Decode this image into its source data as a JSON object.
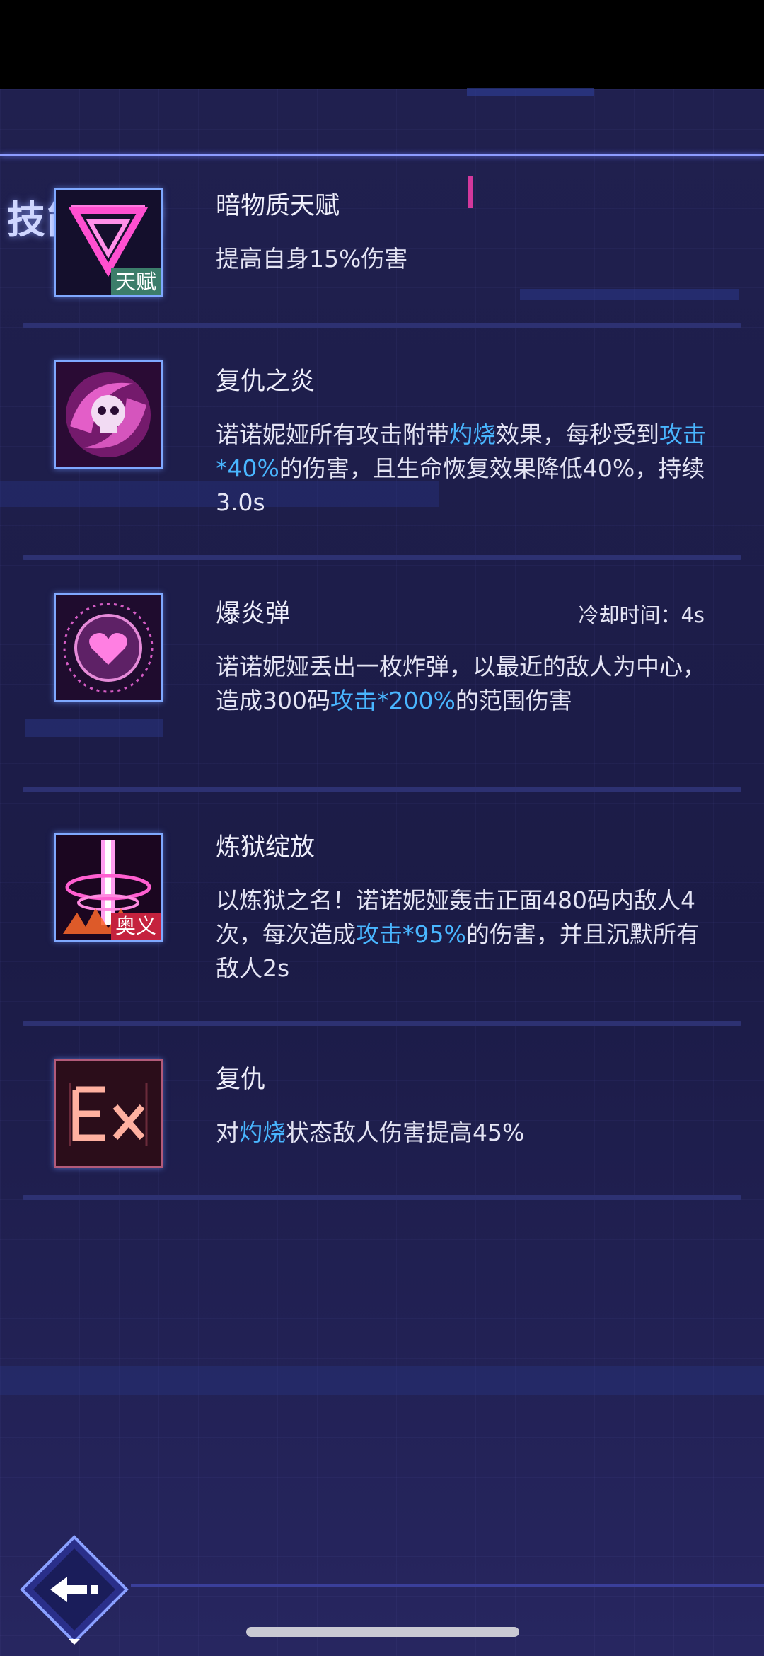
{
  "header": {
    "title": "技能详情"
  },
  "skills": [
    {
      "name": "暗物质天赋",
      "tag": "天赋",
      "cooldown": "",
      "desc": [
        {
          "t": "提高自身15%伤害"
        }
      ]
    },
    {
      "name": "复仇之炎",
      "tag": "",
      "cooldown": "",
      "desc": [
        {
          "t": "诺诺妮娅所有攻击附带"
        },
        {
          "t": "灼烧",
          "hl": true
        },
        {
          "t": "效果，每秒受到"
        },
        {
          "t": "攻击*40%",
          "hl": true
        },
        {
          "t": "的伤害，且生命恢复效果降低40%，持续3.0s"
        }
      ]
    },
    {
      "name": "爆炎弹",
      "tag": "",
      "cooldown": "冷却时间：4s",
      "desc": [
        {
          "t": "诺诺妮娅丢出一枚炸弹，以最近的敌人为中心，造成300码"
        },
        {
          "t": "攻击*200%",
          "hl": true
        },
        {
          "t": "的范围伤害"
        }
      ]
    },
    {
      "name": "炼狱绽放",
      "tag": "奥义",
      "cooldown": "",
      "desc": [
        {
          "t": "以炼狱之名！诺诺妮娅轰击正面480码内敌人4次，每次造成"
        },
        {
          "t": "攻击*95%",
          "hl": true
        },
        {
          "t": "的伤害，并且沉默所有敌人2s"
        }
      ]
    },
    {
      "name": "复仇",
      "tag": "",
      "cooldown": "",
      "desc": [
        {
          "t": "对"
        },
        {
          "t": "灼烧",
          "hl": true
        },
        {
          "t": "状态敌人伤害提高45%"
        }
      ]
    }
  ],
  "icons": [
    "dark-matter-triangle-icon",
    "skull-flame-icon",
    "heart-bomb-icon",
    "pillar-burst-icon",
    "ex-icon",
    "back-arrow-icon"
  ],
  "colors": {
    "highlight": "#49b6ff",
    "talent_tag": "#3c7d6a",
    "ult_tag": "#c5223e",
    "frame": "#7fa8ff"
  }
}
